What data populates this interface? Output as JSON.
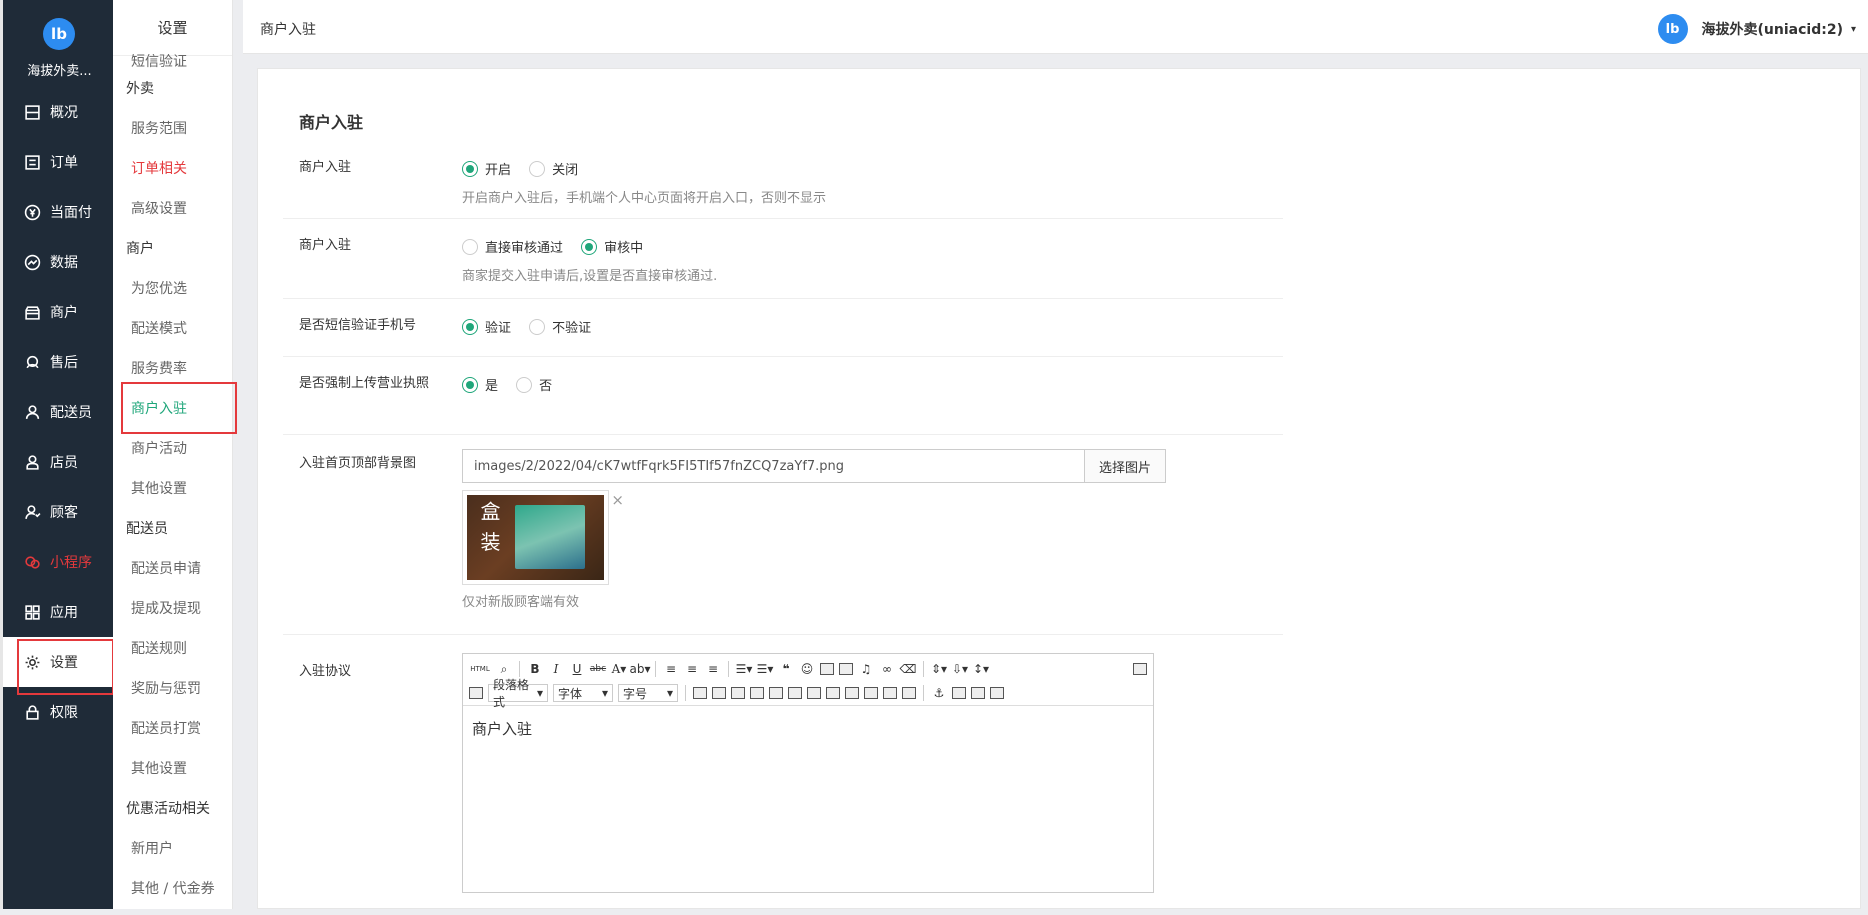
{
  "nav": {
    "logo": "lb",
    "brand": "海拔外卖...",
    "items": [
      {
        "label": "概况",
        "icon": "dashboard-icon"
      },
      {
        "label": "订单",
        "icon": "order-list-icon"
      },
      {
        "label": "当面付",
        "icon": "yuan-coin-icon"
      },
      {
        "label": "数据",
        "icon": "chart-line-icon"
      },
      {
        "label": "商户",
        "icon": "store-icon"
      },
      {
        "label": "售后",
        "icon": "headset-icon"
      },
      {
        "label": "配送员",
        "icon": "courier-icon"
      },
      {
        "label": "店员",
        "icon": "staff-icon"
      },
      {
        "label": "顾客",
        "icon": "customer-icon"
      },
      {
        "label": "小程序",
        "icon": "wechat-miniapp-icon"
      },
      {
        "label": "应用",
        "icon": "apps-grid-icon"
      },
      {
        "label": "设置",
        "icon": "gear-icon"
      },
      {
        "label": "权限",
        "icon": "lock-icon"
      }
    ]
  },
  "sub": {
    "title": "设置",
    "items": [
      {
        "label": "短信验证",
        "type": "cut"
      },
      {
        "label": "外卖",
        "type": "group"
      },
      {
        "label": "服务范围",
        "type": "item"
      },
      {
        "label": "订单相关",
        "type": "red"
      },
      {
        "label": "高级设置",
        "type": "item"
      },
      {
        "label": "商户",
        "type": "group"
      },
      {
        "label": "为您优选",
        "type": "item"
      },
      {
        "label": "配送模式",
        "type": "item"
      },
      {
        "label": "服务费率",
        "type": "item"
      },
      {
        "label": "商户入驻",
        "type": "active"
      },
      {
        "label": "商户活动",
        "type": "item"
      },
      {
        "label": "其他设置",
        "type": "item"
      },
      {
        "label": "配送员",
        "type": "group"
      },
      {
        "label": "配送员申请",
        "type": "item"
      },
      {
        "label": "提成及提现",
        "type": "item"
      },
      {
        "label": "配送规则",
        "type": "item"
      },
      {
        "label": "奖励与惩罚",
        "type": "item"
      },
      {
        "label": "配送员打赏",
        "type": "item"
      },
      {
        "label": "其他设置",
        "type": "item"
      },
      {
        "label": "优惠活动相关",
        "type": "group"
      },
      {
        "label": "新用户",
        "type": "item"
      },
      {
        "label": "其他 / 代金券",
        "type": "item"
      }
    ]
  },
  "header": {
    "breadcrumb": "商户入驻",
    "user": "海拔外卖(uniacid:2)",
    "avatar": "lb",
    "caret": "▾"
  },
  "form": {
    "title": "商户入驻",
    "row1": {
      "label": "商户入驻",
      "on": "开启",
      "off": "关闭",
      "hint": "开启商户入驻后，手机端个人中心页面将开启入口，否则不显示"
    },
    "row2": {
      "label": "商户入驻",
      "opt1": "直接审核通过",
      "opt2": "审核中",
      "hint": "商家提交入驻申请后,设置是否直接审核通过."
    },
    "row3": {
      "label": "是否短信验证手机号",
      "opt1": "验证",
      "opt2": "不验证"
    },
    "row4": {
      "label": "是否强制上传营业执照",
      "opt1": "是",
      "opt2": "否"
    },
    "row5": {
      "label": "入驻首页顶部背景图",
      "value": "images/2/2022/04/cK7wtfFqrk5FI5TIf57fnZCQ7zaYf7.png",
      "button": "选择图片",
      "thumb_text": "盒 装",
      "remove": "×",
      "hint": "仅对新版顾客端有效"
    },
    "row6": {
      "label": "入驻协议",
      "content": "商户入驻",
      "select_para": "段落格式",
      "select_font": "字体",
      "select_size": "字号",
      "html_btn": "HTML"
    }
  }
}
